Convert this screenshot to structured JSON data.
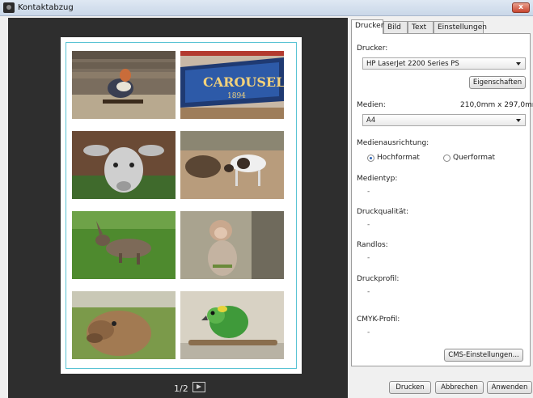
{
  "window": {
    "title": "Kontaktabzug",
    "close_label": "x"
  },
  "preview": {
    "page_indicator": "1/2",
    "thumbnails": [
      {
        "subject": "bird-on-branch"
      },
      {
        "subject": "carousel-sign"
      },
      {
        "subject": "animal-skull"
      },
      {
        "subject": "goat-and-log"
      },
      {
        "subject": "hare-on-grass"
      },
      {
        "subject": "monkey"
      },
      {
        "subject": "camel"
      },
      {
        "subject": "parrot"
      }
    ]
  },
  "panel": {
    "tabs": [
      "Drucker",
      "Bild",
      "Text",
      "Einstellungen"
    ],
    "active_tab": "Drucker",
    "printer_label": "Drucker:",
    "printer_value": "HP LaserJet 2200 Series PS",
    "properties_button": "Eigenschaften",
    "media_label": "Medien:",
    "media_size": "210,0mm x 297,0mm",
    "media_value": "A4",
    "orientation_label": "Medienausrichtung:",
    "orientation_portrait": "Hochformat",
    "orientation_landscape": "Querformat",
    "orientation_selected": "Hochformat",
    "media_type_label": "Medientyp:",
    "media_type_value": "-",
    "quality_label": "Druckqualität:",
    "quality_value": "-",
    "borderless_label": "Randlos:",
    "borderless_value": "-",
    "profile_label": "Druckprofil:",
    "profile_value": "-",
    "cmyk_label": "CMYK-Profil:",
    "cmyk_value": "-",
    "cms_button": "CMS-Einstellungen...",
    "print_button": "Drucken",
    "cancel_button": "Abbrechen",
    "apply_button": "Anwenden"
  }
}
